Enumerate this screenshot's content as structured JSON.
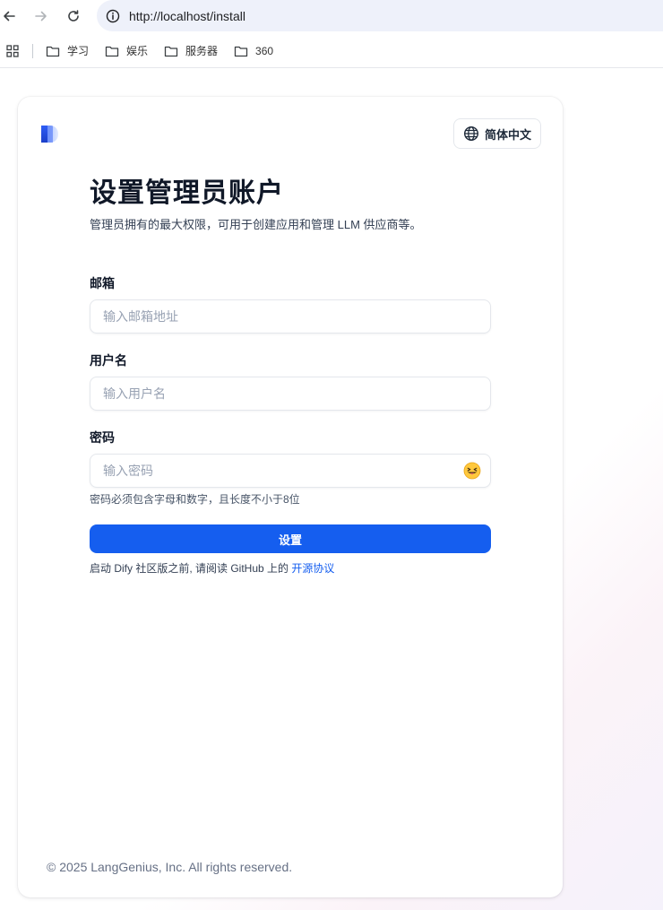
{
  "browser": {
    "url": "http://localhost/install",
    "bookmarks": [
      "学习",
      "娱乐",
      "服务器",
      "360"
    ]
  },
  "header": {
    "language_label": "简体中文"
  },
  "form": {
    "title": "设置管理员账户",
    "subtitle": "管理员拥有的最大权限，可用于创建应用和管理 LLM 供应商等。",
    "email": {
      "label": "邮箱",
      "placeholder": "输入邮箱地址",
      "value": ""
    },
    "username": {
      "label": "用户名",
      "placeholder": "输入用户名",
      "value": ""
    },
    "password": {
      "label": "密码",
      "placeholder": "输入密码",
      "value": "",
      "toggle_icon": "😝",
      "hint": "密码必须包含字母和数字，且长度不小于8位"
    },
    "submit_label": "设置",
    "notice_prefix": "启动 Dify 社区版之前, 请阅读 GitHub 上的 ",
    "notice_link": "开源协议"
  },
  "footer": {
    "copyright": "© 2025 LangGenius, Inc. All rights reserved."
  },
  "colors": {
    "primary": "#155eef",
    "text": "#101828",
    "muted": "#667085"
  }
}
